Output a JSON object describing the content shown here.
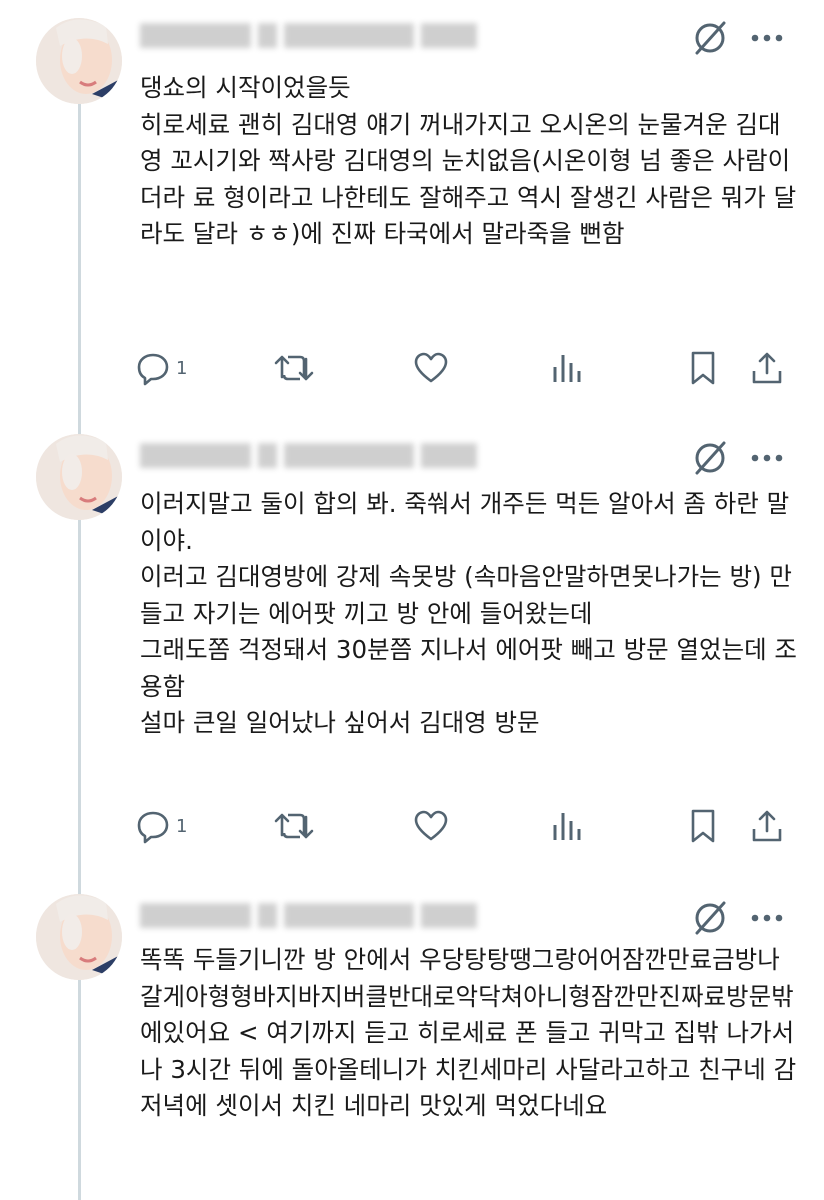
{
  "colors": {
    "icon": "#536471",
    "text": "#0f1419",
    "thread_line": "#cfd9de"
  },
  "icons": {
    "grok": "grok-icon",
    "more": "more-icon",
    "reply": "reply-icon",
    "repost": "repost-icon",
    "like": "heart-icon",
    "views": "views-icon",
    "bookmark": "bookmark-icon",
    "share": "share-icon"
  },
  "tweets": [
    {
      "text": "댕쇼의 시작이었을듯\n히로세료 괜히 김대영 얘기 꺼내가지고 오시온의 눈물겨운 김대영 꼬시기와 짝사랑 김대영의 눈치없음(시온이형 넘 좋은 사람이더라 료 형이라고 나한테도 잘해주고 역시 잘생긴 사람은 뭐가 달라도 달라 ㅎㅎ)에 진짜 타국에서 말라죽을 뻔함",
      "reply_count": "1"
    },
    {
      "text": "이러지말고 둘이 합의 봐. 죽쒀서 개주든 먹든 알아서 좀 하란 말이야.\n이러고 김대영방에 강제 속못방 (속마음안말하면못나가는 방) 만들고 자기는 에어팟 끼고 방 안에 들어왔는데\n그래도쫌 걱정돼서 30분쯤 지나서 에어팟 빼고 방문 열었는데 조용함\n설마 큰일 일어났나 싶어서 김대영 방문",
      "reply_count": "1"
    },
    {
      "text": "똑똑 두들기니깐 방 안에서 우당탕탕땡그랑어어잠깐만료금방나갈게아형형바지바지버클반대로악닥쳐아니형잠깐만진짜료방문밖에있어요 < 여기까지 듣고 히로세료 폰 들고 귀막고 집밖 나가서 나 3시간 뒤에 돌아올테니가 치킨세마리 사달라고하고 친구네 감\n저녁에 셋이서 치킨 네마리 맛있게 먹었다네요"
    }
  ]
}
